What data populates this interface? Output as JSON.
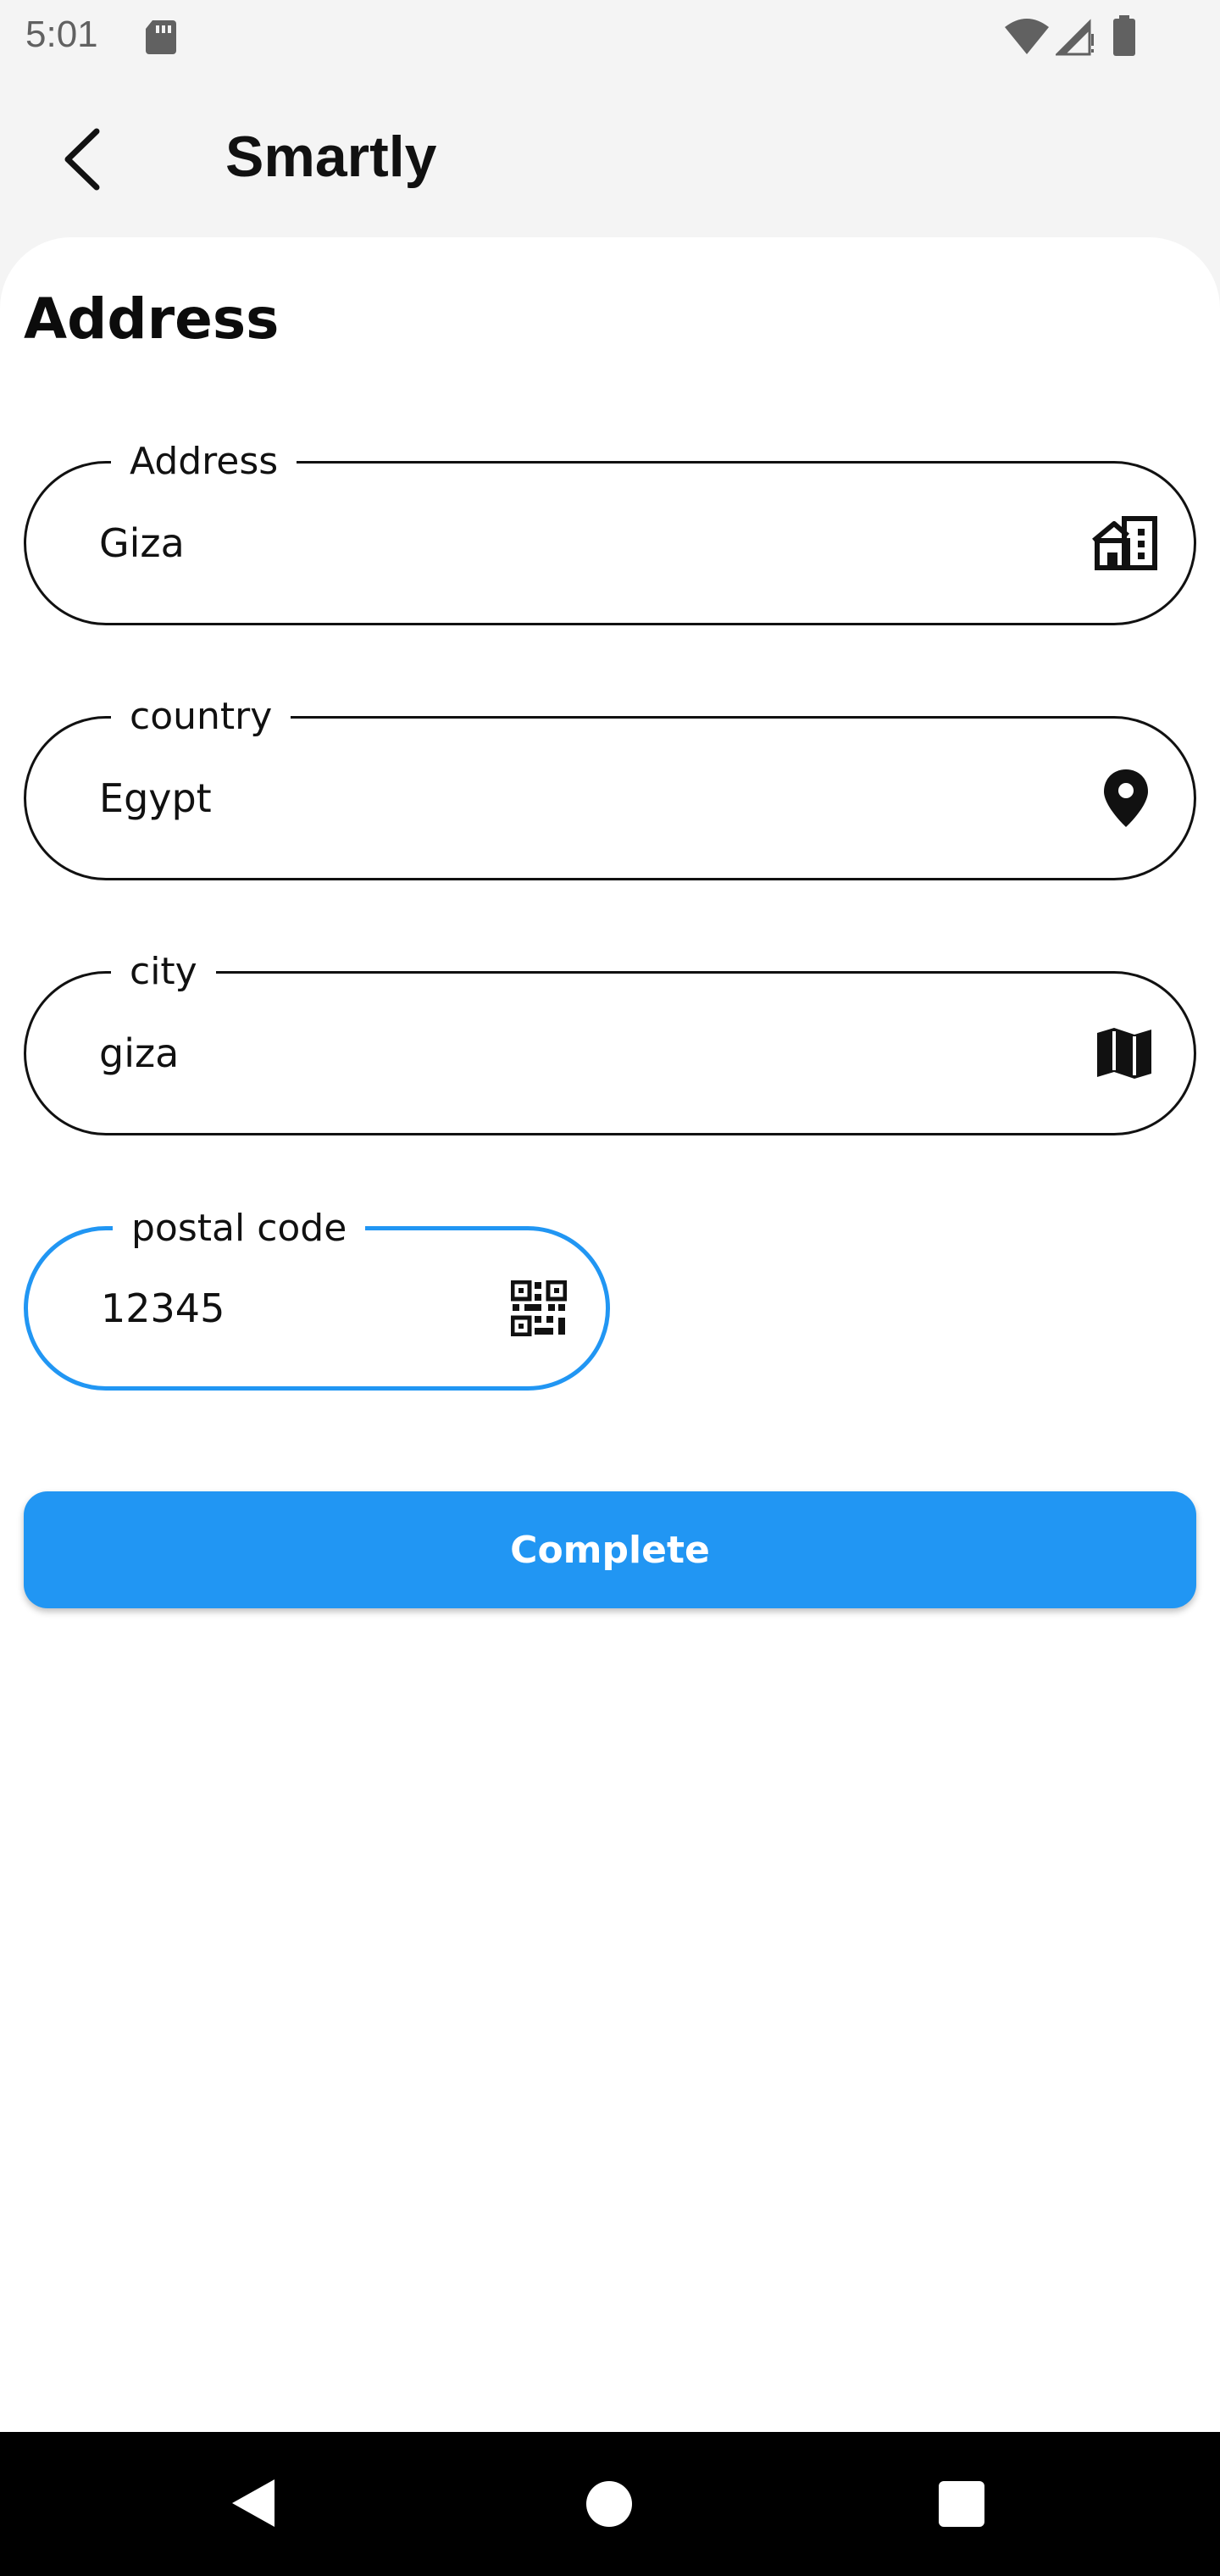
{
  "status_bar": {
    "time": "5:01",
    "icons": [
      "sd-card-icon",
      "wifi-icon",
      "signal-icon",
      "battery-icon"
    ],
    "text_color": "#616161"
  },
  "app_bar": {
    "title": "Smartly",
    "back_icon": "arrow-back-icon"
  },
  "form": {
    "section_title": "Address",
    "fields": [
      {
        "label": "Address",
        "value": "Giza",
        "icon": "home-building-icon",
        "focused": false
      },
      {
        "label": "country",
        "value": "Egypt",
        "icon": "location-pin-icon",
        "focused": false
      },
      {
        "label": "city",
        "value": "giza",
        "icon": "map-icon",
        "focused": false
      },
      {
        "label": "postal code",
        "value": "12345",
        "icon": "qr-code-icon",
        "focused": true
      }
    ],
    "submit_label": "Complete"
  },
  "nav_bar": {
    "icons": [
      "nav-back-icon",
      "nav-home-icon",
      "nav-recents-icon"
    ]
  },
  "colors": {
    "accent": "#2196f3",
    "background": "#f4f4f4",
    "sheet": "#ffffff",
    "field_border": "#111111",
    "nav_bar": "#000000"
  }
}
